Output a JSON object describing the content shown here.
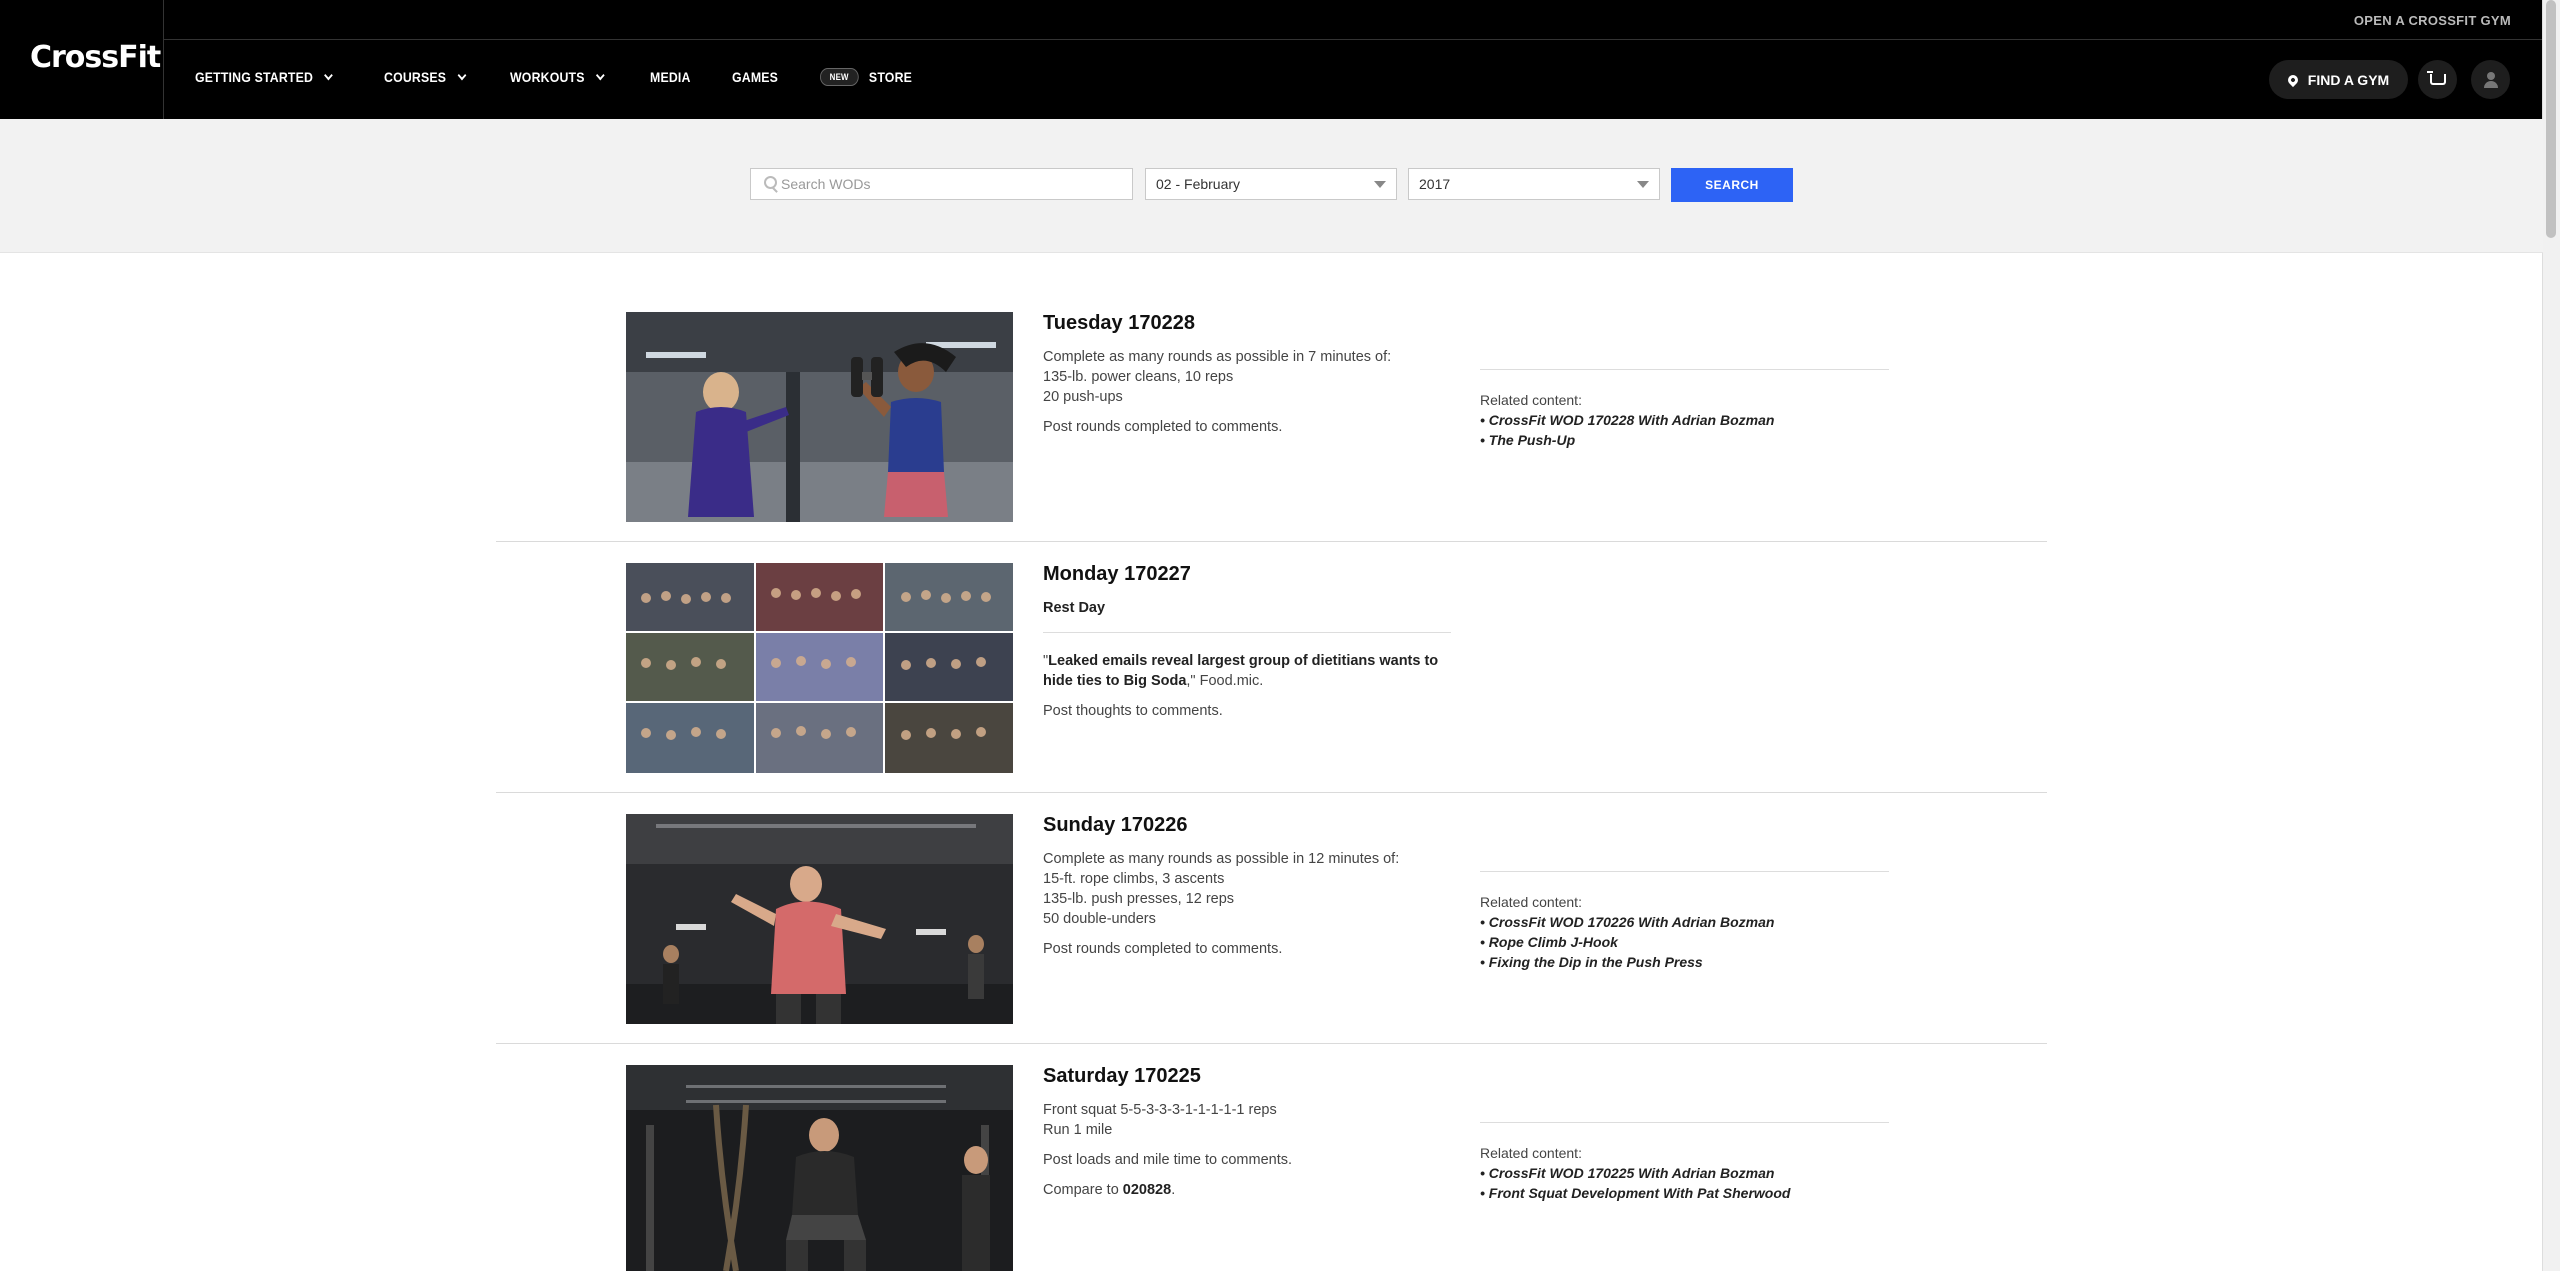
{
  "header": {
    "logo": "CrossFit",
    "open_gym_link": "OPEN A CROSSFIT GYM",
    "nav": [
      {
        "label": "GETTING STARTED",
        "has_dropdown": true
      },
      {
        "label": "COURSES",
        "has_dropdown": true
      },
      {
        "label": "WORKOUTS",
        "has_dropdown": true
      },
      {
        "label": "MEDIA",
        "has_dropdown": false
      },
      {
        "label": "GAMES",
        "has_dropdown": false
      },
      {
        "label": "STORE",
        "has_dropdown": false,
        "badge": "NEW"
      }
    ],
    "find_gym": "FIND A GYM",
    "icons": [
      "map-pin-icon",
      "cart-icon",
      "user-icon"
    ]
  },
  "search": {
    "placeholder": "Search WODs",
    "month": "02 - February",
    "year": "2017",
    "button": "SEARCH"
  },
  "colors": {
    "header_bg": "#000000",
    "search_button": "#2d63f5",
    "search_band": "#f2f2f2"
  },
  "wods": [
    {
      "title": "Tuesday 170228",
      "lines": [
        "Complete as many rounds as possible in 7 minutes of:",
        "135-lb. power cleans, 10 reps",
        "20 push-ups"
      ],
      "note": "Post rounds completed to comments.",
      "related_label": "Related content:",
      "related": [
        "• CrossFit WOD 170228 With Adrian Bozman",
        "• The Push-Up"
      ]
    },
    {
      "title": "Monday 170227",
      "rest": "Rest Day",
      "quote_open": "\"",
      "quote_bold": "Leaked emails reveal largest group of dietitians wants to hide ties to Big Soda",
      "quote_close": ",\" Food.mic.",
      "note": "Post thoughts to comments."
    },
    {
      "title": "Sunday 170226",
      "lines": [
        "Complete as many rounds as possible in 12 minutes of:",
        "15-ft. rope climbs, 3 ascents",
        "135-lb. push presses, 12 reps",
        "50 double-unders"
      ],
      "note": "Post rounds completed to comments.",
      "related_label": "Related content:",
      "related": [
        "• CrossFit WOD 170226 With Adrian Bozman",
        "• Rope Climb J-Hook",
        "• Fixing the Dip in the Push Press"
      ]
    },
    {
      "title": "Saturday 170225",
      "lines": [
        "Front squat 5-5-3-3-3-1-1-1-1-1 reps",
        "Run 1 mile"
      ],
      "note": "Post loads and mile time to comments.",
      "compare_prefix": "Compare to ",
      "compare_link": "020828",
      "compare_suffix": ".",
      "related_label": "Related content:",
      "related": [
        "• CrossFit WOD 170225 With Adrian Bozman",
        "• Front Squat Development With Pat Sherwood"
      ]
    }
  ]
}
